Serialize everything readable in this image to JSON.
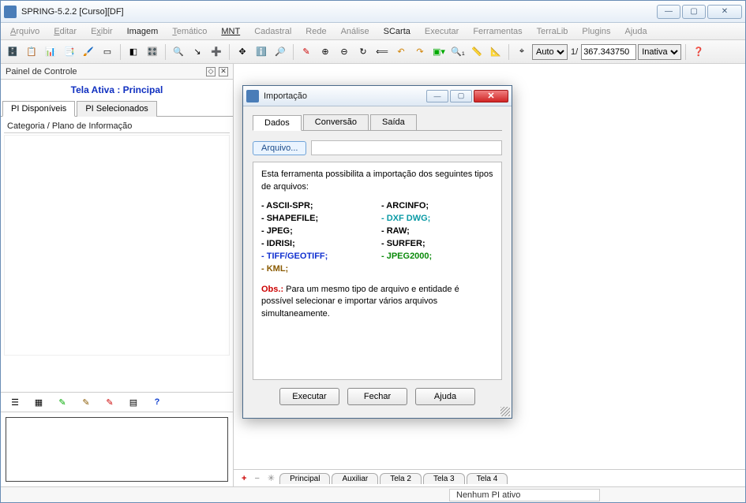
{
  "window": {
    "title": "SPRING-5.2.2 [Curso][DF]",
    "min": "—",
    "max": "▢",
    "close": "✕"
  },
  "menu": {
    "arquivo": "Arquivo",
    "editar": "Editar",
    "exibir": "Exibir",
    "imagem": "Imagem",
    "tematico": "Temático",
    "mnt": "MNT",
    "cadastral": "Cadastral",
    "rede": "Rede",
    "analise": "Análise",
    "scarta": "SCarta",
    "executar": "Executar",
    "ferramentas": "Ferramentas",
    "terralib": "TerraLib",
    "plugins": "Plugins",
    "ajuda": "Ajuda"
  },
  "toolbar": {
    "auto_label": "Auto",
    "frac": "1/",
    "scale": "367.343750",
    "inativa_label": "Inativa"
  },
  "panel": {
    "title": "Painel de Controle",
    "tela_ativa": "Tela Ativa : Principal",
    "tabs": {
      "disponiveis": "PI Disponíveis",
      "selecionados": "PI Selecionados"
    },
    "tree_header": "Categoria / Plano de Informação"
  },
  "canvas_tabs": {
    "principal": "Principal",
    "auxiliar": "Auxiliar",
    "tela2": "Tela 2",
    "tela3": "Tela 3",
    "tela4": "Tela 4"
  },
  "status": {
    "right": "Nenhum PI ativo"
  },
  "dialog": {
    "title": "Importação",
    "tabs": {
      "dados": "Dados",
      "conversao": "Conversão",
      "saida": "Saída"
    },
    "arquivo_btn": "Arquivo...",
    "desc": "Esta ferramenta possibilita a importação dos seguintes tipos de arquivos:",
    "formats_left": [
      "- ASCII-SPR;",
      "- SHAPEFILE;",
      "- JPEG;",
      "- IDRISI;",
      "- TIFF/GEOTIFF;",
      "- KML;"
    ],
    "formats_right": [
      "- ARCINFO;",
      "- DXF DWG;",
      "- RAW;",
      "- SURFER;",
      "- JPEG2000;"
    ],
    "obs_label": "Obs.:",
    "obs_text": " Para um mesmo tipo de arquivo e entidade é possível selecionar e importar vários arquivos simultaneamente.",
    "buttons": {
      "executar": "Executar",
      "fechar": "Fechar",
      "ajuda": "Ajuda"
    }
  }
}
